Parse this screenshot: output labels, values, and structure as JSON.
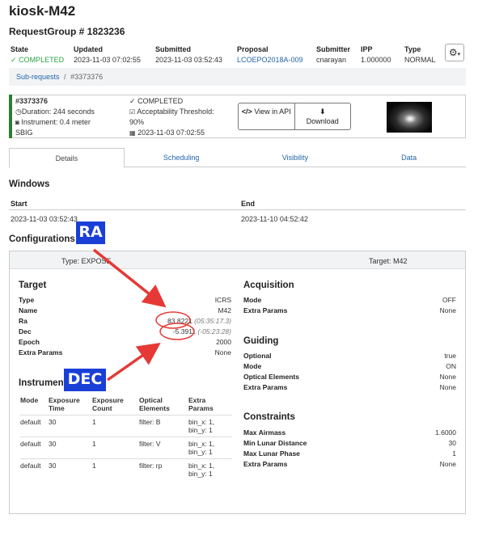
{
  "page": {
    "title": "kiosk-M42",
    "request_group": "RequestGroup # 1823236"
  },
  "meta": {
    "state_label": "State",
    "state_value": "COMPLETED",
    "updated_label": "Updated",
    "updated_value": "2023-11-03 07:02:55",
    "submitted_label": "Submitted",
    "submitted_value": "2023-11-03 03:52:43",
    "proposal_label": "Proposal",
    "proposal_value": "LCOEPO2018A-009",
    "submitter_label": "Submitter",
    "submitter_value": "cnarayan",
    "ipp_label": "IPP",
    "ipp_value": "1.000000",
    "type_label": "Type",
    "type_value": "NORMAL"
  },
  "breadcrumb": {
    "parent": "Sub-requests",
    "separator": "/",
    "current": "#3373376"
  },
  "subrequest": {
    "id": "#3373376",
    "duration": "Duration: 244 seconds",
    "instrument": "Instrument: 0.4 meter",
    "instrument_cont": "SBIG",
    "status": "COMPLETED",
    "threshold": "Acceptability Threshold:",
    "threshold_value": "90%",
    "date": "2023-11-03 07:02:55",
    "view_api": "View in API",
    "download": "Download"
  },
  "tabs": [
    "Details",
    "Scheduling",
    "Visibility",
    "Data"
  ],
  "windows": {
    "heading": "Windows",
    "start_label": "Start",
    "end_label": "End",
    "start_value": "2023-11-03 03:52:43",
    "end_value": "2023-11-10 04:52:42"
  },
  "configurations": {
    "heading": "Configurations",
    "type": "Type: EXPOSE",
    "target": "Target: M42"
  },
  "target": {
    "heading": "Target",
    "rows": [
      {
        "label": "Type",
        "value": "ICRS",
        "extra": ""
      },
      {
        "label": "Name",
        "value": "M42",
        "extra": ""
      },
      {
        "label": "Ra",
        "value": "83.8221",
        "extra": "(05:35:17.3)"
      },
      {
        "label": "Dec",
        "value": "-5.3911",
        "extra": "(-05:23:28)"
      },
      {
        "label": "Epoch",
        "value": "2000",
        "extra": ""
      },
      {
        "label": "Extra Params",
        "value": "None",
        "extra": ""
      }
    ]
  },
  "instrument": {
    "heading": "Instrument",
    "columns": [
      "Mode",
      "Exposure Time",
      "Exposure Count",
      "Optical Elements",
      "Extra Params"
    ],
    "rows": [
      [
        "default",
        "30",
        "1",
        "filter: B",
        "bin_x: 1, bin_y: 1"
      ],
      [
        "default",
        "30",
        "1",
        "filter: V",
        "bin_x: 1, bin_y: 1"
      ],
      [
        "default",
        "30",
        "1",
        "filter: rp",
        "bin_x: 1, bin_y: 1"
      ]
    ]
  },
  "acquisition": {
    "heading": "Acquisition",
    "rows": [
      {
        "label": "Mode",
        "value": "OFF"
      },
      {
        "label": "Extra Params",
        "value": "None"
      }
    ]
  },
  "guiding": {
    "heading": "Guiding",
    "rows": [
      {
        "label": "Optional",
        "value": "true"
      },
      {
        "label": "Mode",
        "value": "ON"
      },
      {
        "label": "Optical Elements",
        "value": "None"
      },
      {
        "label": "Extra Params",
        "value": "None"
      }
    ]
  },
  "constraints": {
    "heading": "Constraints",
    "rows": [
      {
        "label": "Max Airmass",
        "value": "1.6000"
      },
      {
        "label": "Min Lunar Distance",
        "value": "30"
      },
      {
        "label": "Max Lunar Phase",
        "value": "1"
      },
      {
        "label": "Extra Params",
        "value": "None"
      }
    ]
  },
  "annotations": {
    "ra": "RA",
    "dec": "DEC",
    "color": "#e53935",
    "label_bg": "#1a3fd6"
  }
}
